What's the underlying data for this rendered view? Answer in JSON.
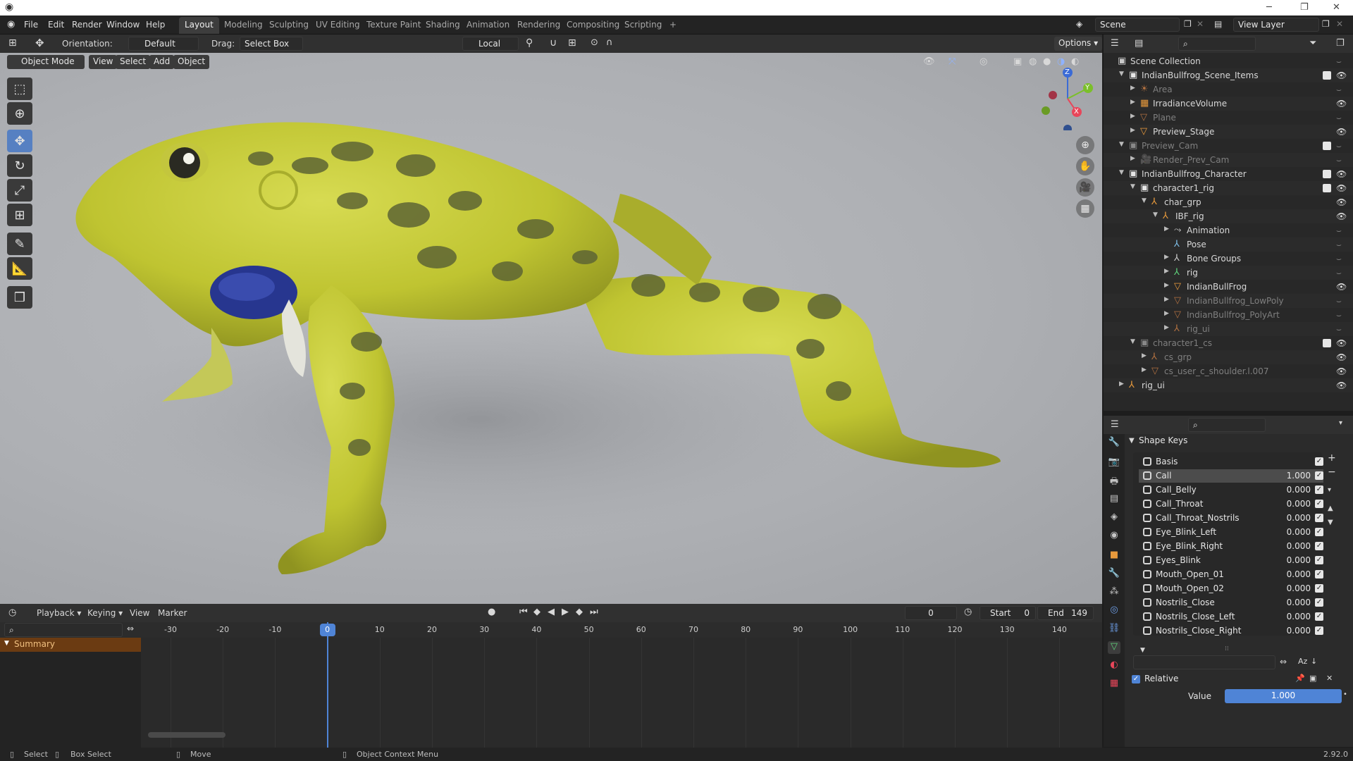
{
  "titlebar": {
    "minimize": "─",
    "maximize": "❐",
    "close": "✕"
  },
  "topbar": {
    "menus": [
      "File",
      "Edit",
      "Render",
      "Window",
      "Help"
    ],
    "workspaces": [
      "Layout",
      "Modeling",
      "Sculpting",
      "UV Editing",
      "Texture Paint",
      "Shading",
      "Animation",
      "Rendering",
      "Compositing",
      "Scripting"
    ],
    "active_workspace": "Layout",
    "add_tab": "+",
    "scene_value": "Scene",
    "view_layer_value": "View Layer"
  },
  "viewport_header": {
    "orientation_label": "Orientation:",
    "orientation_value": "Default",
    "drag_label": "Drag:",
    "drag_value": "Select Box",
    "pivot_value": "Local",
    "options_label": "Options",
    "mode_value": "Object Mode",
    "view_menu": "View",
    "select_menu": "Select",
    "add_menu": "Add",
    "object_menu": "Object"
  },
  "gizmo": {
    "z": "Z",
    "y": "Y",
    "x": "X"
  },
  "outliner": {
    "rows": [
      {
        "label": "Scene Collection",
        "dim": false
      },
      {
        "label": "IndianBullfrog_Scene_Items",
        "dim": false
      },
      {
        "label": "Area",
        "dim": true
      },
      {
        "label": "IrradianceVolume",
        "dim": false
      },
      {
        "label": "Plane",
        "dim": true
      },
      {
        "label": "Preview_Stage",
        "dim": false
      },
      {
        "label": "Preview_Cam",
        "dim": true
      },
      {
        "label": "Render_Prev_Cam",
        "dim": true
      },
      {
        "label": "IndianBullfrog_Character",
        "dim": false
      },
      {
        "label": "character1_rig",
        "dim": false
      },
      {
        "label": "char_grp",
        "dim": false
      },
      {
        "label": "IBF_rig",
        "dim": false
      },
      {
        "label": "Animation",
        "dim": false
      },
      {
        "label": "Pose",
        "dim": false
      },
      {
        "label": "Bone Groups",
        "dim": false
      },
      {
        "label": "rig",
        "dim": false
      },
      {
        "label": "IndianBullFrog",
        "dim": false
      },
      {
        "label": "IndianBullfrog_LowPoly",
        "dim": true
      },
      {
        "label": "IndianBullfrog_PolyArt",
        "dim": true
      },
      {
        "label": "rig_ui",
        "dim": true
      },
      {
        "label": "character1_cs",
        "dim": true
      },
      {
        "label": "cs_grp",
        "dim": true
      },
      {
        "label": "cs_user_c_shoulder.l.007",
        "dim": true
      },
      {
        "label": "rig_ui",
        "dim": false
      }
    ]
  },
  "properties": {
    "panel_title": "Shape Keys",
    "shape_keys": [
      {
        "name": "Basis",
        "value": ""
      },
      {
        "name": "Call",
        "value": "1.000"
      },
      {
        "name": "Call_Belly",
        "value": "0.000"
      },
      {
        "name": "Call_Throat",
        "value": "0.000"
      },
      {
        "name": "Call_Throat_Nostrils",
        "value": "0.000"
      },
      {
        "name": "Eye_Blink_Left",
        "value": "0.000"
      },
      {
        "name": "Eye_Blink_Right",
        "value": "0.000"
      },
      {
        "name": "Eyes_Blink",
        "value": "0.000"
      },
      {
        "name": "Mouth_Open_01",
        "value": "0.000"
      },
      {
        "name": "Mouth_Open_02",
        "value": "0.000"
      },
      {
        "name": "Nostrils_Close",
        "value": "0.000"
      },
      {
        "name": "Nostrils_Close_Left",
        "value": "0.000"
      },
      {
        "name": "Nostrils_Close_Right",
        "value": "0.000"
      }
    ],
    "relative_label": "Relative",
    "value_label": "Value",
    "value_field": "1.000",
    "value_fraction": 1.0
  },
  "timeline": {
    "playback_menu": "Playback",
    "keying_menu": "Keying",
    "view_menu": "View",
    "marker_menu": "Marker",
    "current_frame": "0",
    "start_label": "Start",
    "start_value": "0",
    "end_label": "End",
    "end_value": "149",
    "ruler_ticks": [
      "-30",
      "-20",
      "-10",
      "0",
      "10",
      "20",
      "30",
      "40",
      "50",
      "60",
      "70",
      "80",
      "90",
      "100",
      "110",
      "120",
      "130",
      "140"
    ],
    "summary_label": "Summary"
  },
  "statusbar": {
    "select": "Select",
    "box_select": "Box Select",
    "move": "Move",
    "context_menu": "Object Context Menu",
    "version": "2.92.0"
  },
  "colors": {
    "accent_blue": "#5680c2",
    "active_tab": "#3d3d3d",
    "summary_orange": "#6b3b12",
    "frog_yellow": "#c9cf3a"
  }
}
